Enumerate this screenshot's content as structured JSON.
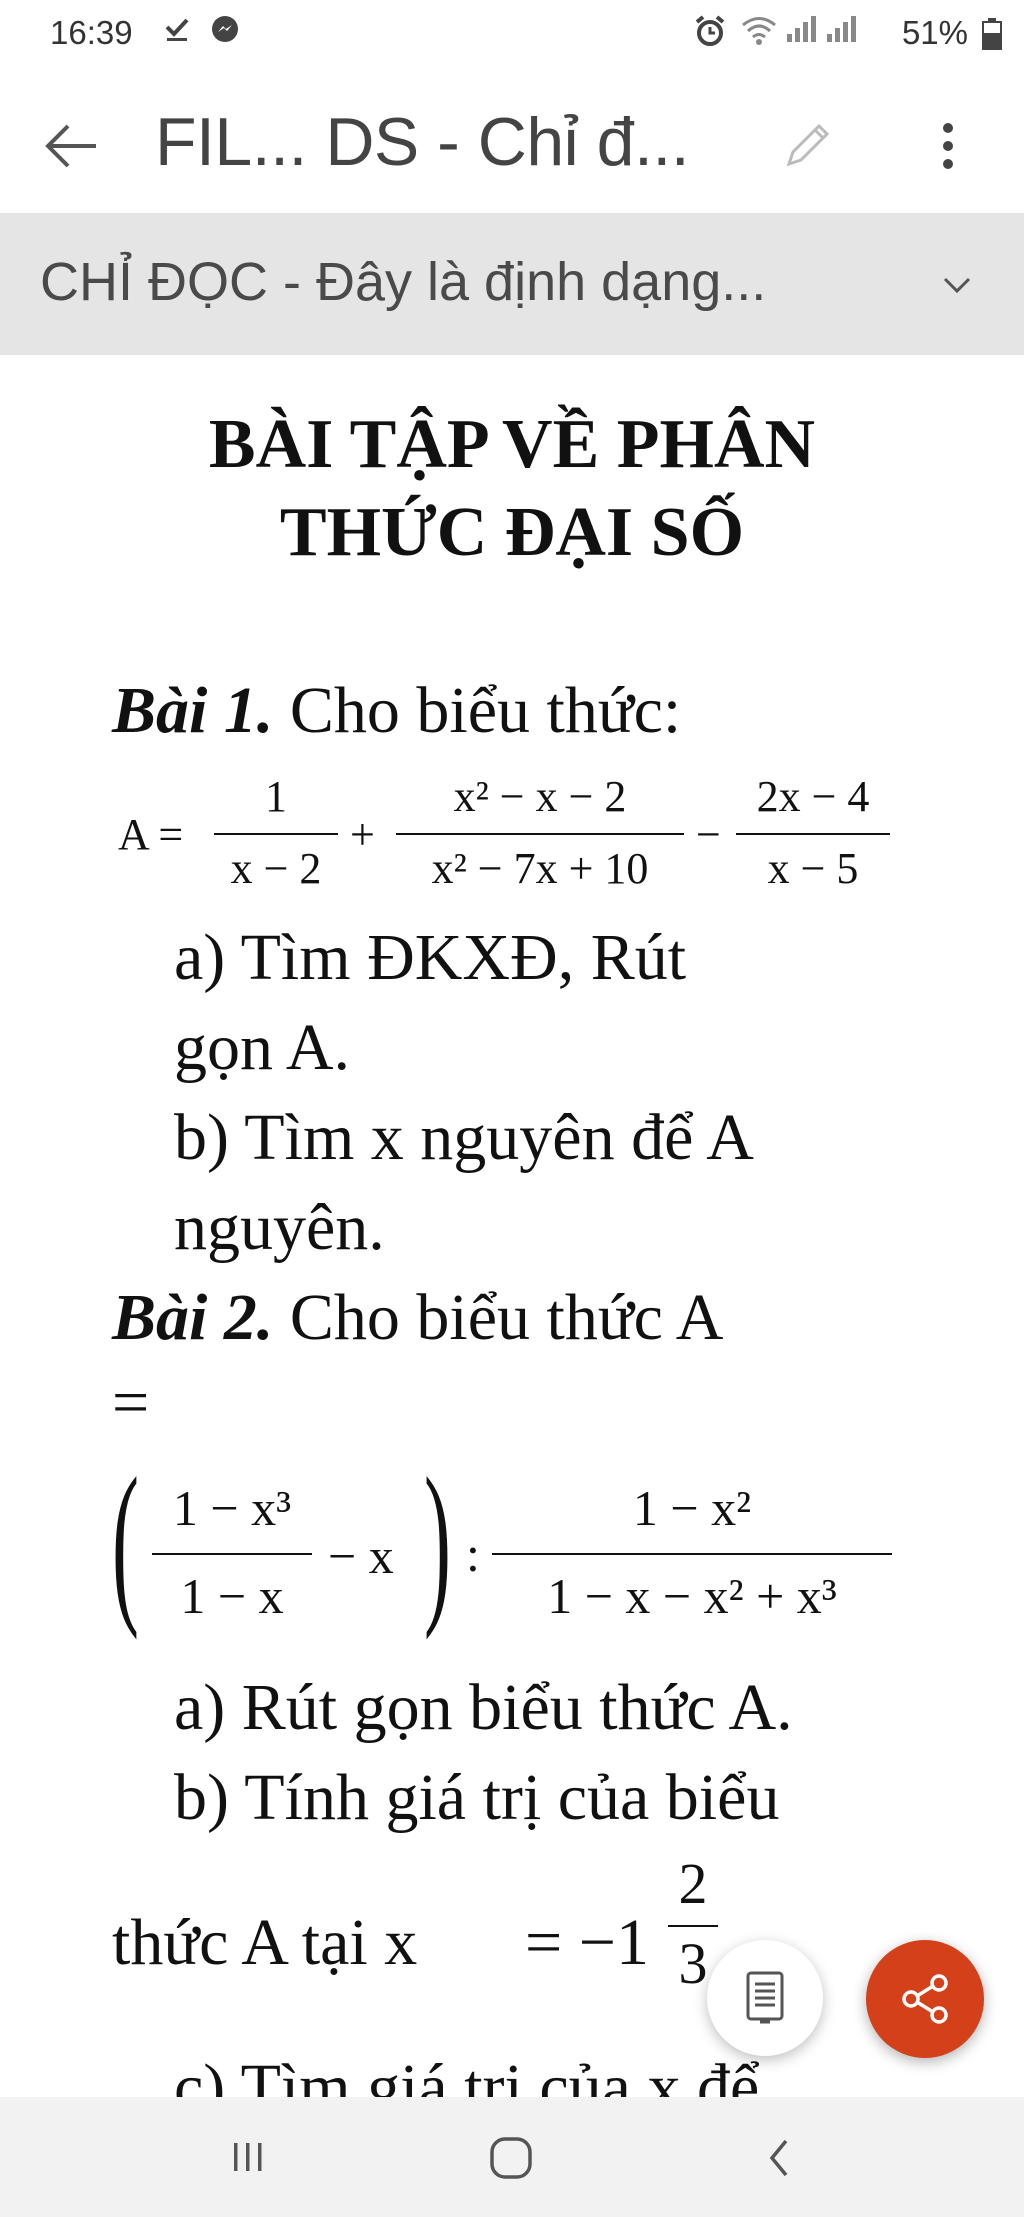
{
  "status_bar": {
    "time": "16:39",
    "battery": "51%"
  },
  "app_bar": {
    "title": "FIL... DS - Chỉ đ..."
  },
  "banner": {
    "text": "CHỈ ĐỌC - Đây là định dạng..."
  },
  "document": {
    "title_line1": "BÀI TẬP VỀ PHÂN",
    "title_line2": "THỨC ĐẠI SỐ",
    "bai1_label": "Bài 1.",
    "bai1_text": " Cho biểu thức:",
    "bai1_formula": {
      "lhs": "A =",
      "f1_num": "1",
      "f1_den": "x − 2",
      "plus": "+",
      "f2_num": "x² − x − 2",
      "f2_den": "x² − 7x + 10",
      "minus": "−",
      "f3_num": "2x − 4",
      "f3_den": "x − 5"
    },
    "bai1_a_line1": "a) Tìm ĐKXĐ, Rút",
    "bai1_a_line2": "gọn A.",
    "bai1_b_line1": "b) Tìm x nguyên để A",
    "bai1_b_line2": "nguyên.",
    "bai2_label": "Bài 2.",
    "bai2_text": " Cho biểu thức  A",
    "bai2_eq": "=",
    "bai2_formula": {
      "g1_num": "1 − x³",
      "g1_den": "1 − x",
      "minus_x": "− x",
      "colon": ":",
      "g2_num": "1 − x²",
      "g2_den": "1 − x − x² + x³"
    },
    "bai2_a": "a) Rút gọn biểu thức A.",
    "bai2_b_line1": "b) Tính giá trị của biểu",
    "bai2_b_line2": "thức A tại x",
    "bai2_b_value": "= −1",
    "bai2_b_frac_num": "2",
    "bai2_b_frac_den": "3",
    "bai2_c_partial": "c) Tìm giá trị của x để"
  },
  "colors": {
    "share_button": "#d3401a",
    "banner_bg": "#e5e5e5"
  },
  "icons": {
    "back": "arrow-left-icon",
    "edit": "pencil-icon",
    "more": "more-vert-icon",
    "chevron": "chevron-down-icon",
    "read_mode": "document-icon",
    "share": "share-icon"
  }
}
